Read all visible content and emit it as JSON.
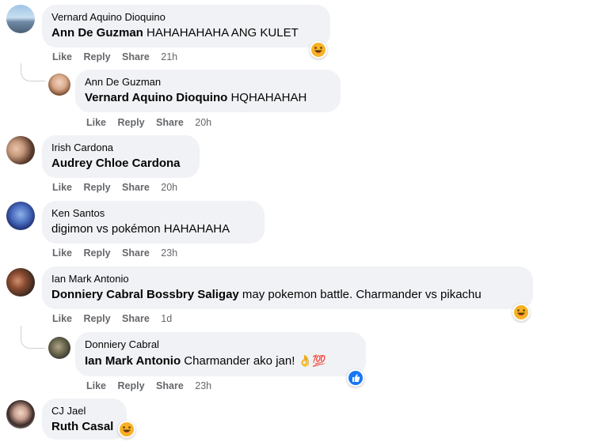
{
  "comments": [
    {
      "author": "Vernard Aquino Dioquino",
      "mention": "Ann De Guzman",
      "text": "HAHAHAHAHA ANG KULET",
      "actions": {
        "like": "Like",
        "reply": "Reply",
        "share": "Share",
        "time": "21h"
      },
      "reaction": "haha-emoji"
    },
    {
      "author": "Ann De Guzman",
      "mention": "Vernard Aquino Dioquino",
      "text": "HQHAHAHAH",
      "actions": {
        "like": "Like",
        "reply": "Reply",
        "share": "Share",
        "time": "20h"
      }
    },
    {
      "author": "Irish Cardona",
      "mention": "Audrey Chloe Cardona",
      "text": "",
      "actions": {
        "like": "Like",
        "reply": "Reply",
        "share": "Share",
        "time": "20h"
      }
    },
    {
      "author": "Ken Santos",
      "mention": "",
      "text": "digimon vs pokémon HAHAHAHA",
      "actions": {
        "like": "Like",
        "reply": "Reply",
        "share": "Share",
        "time": "23h"
      }
    },
    {
      "author": "Ian Mark Antonio",
      "mention": "Donniery Cabral Bossbry Saligay",
      "text": "may pokemon battle. Charmander vs pikachu",
      "actions": {
        "like": "Like",
        "reply": "Reply",
        "share": "Share",
        "time": "1d"
      },
      "reaction": "haha-emoji"
    },
    {
      "author": "Donniery Cabral",
      "mention": "Ian Mark Antonio",
      "text": "Charmander ako jan!",
      "emoji_suffix": "👌💯",
      "actions": {
        "like": "Like",
        "reply": "Reply",
        "share": "Share",
        "time": "23h"
      },
      "reaction": "like-icon"
    },
    {
      "author": "CJ Jael",
      "mention": "Ruth Casal",
      "text": "",
      "reaction": "haha-emoji"
    }
  ],
  "colors": {
    "bubble": "#f0f2f5",
    "action_text": "#65676b",
    "haha_yellow": "#f7b125",
    "like_blue": "#1877f2"
  }
}
